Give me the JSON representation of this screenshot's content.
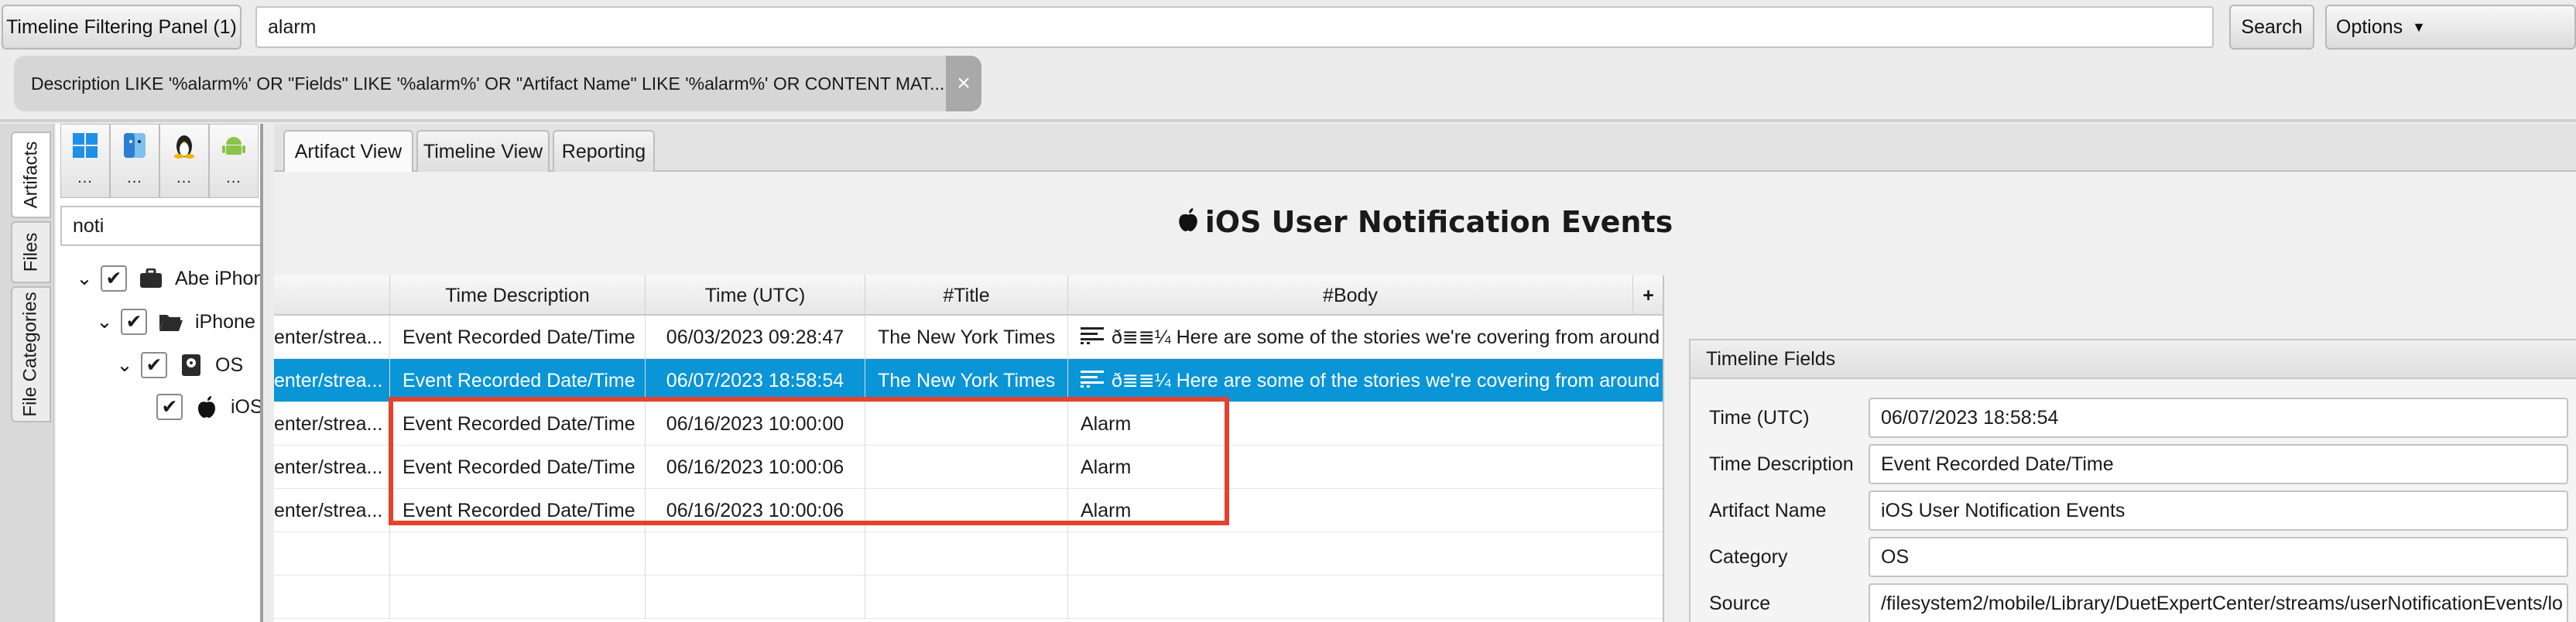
{
  "toolbar": {
    "filter_panel_button": "Timeline Filtering Panel (1)",
    "search_value": "alarm",
    "search_button": "Search",
    "options_button": "Options"
  },
  "filter_chip": {
    "text": "Description LIKE '%alarm%' OR \"Fields\" LIKE '%alarm%' OR \"Artifact Name\" LIKE '%alarm%' OR CONTENT MAT...",
    "close": "×"
  },
  "side_tabs": [
    "Artifacts",
    "Files",
    "File Categories"
  ],
  "os_buttons": [
    {
      "icon": "windows-icon",
      "label": "..."
    },
    {
      "icon": "mac-finder-icon",
      "label": "..."
    },
    {
      "icon": "linux-icon",
      "label": "..."
    },
    {
      "icon": "android-icon",
      "label": "..."
    }
  ],
  "tree_filter": "noti",
  "tree": [
    {
      "label": "Abe iPhon",
      "icon": "briefcase-icon"
    },
    {
      "label": "iPhone X",
      "icon": "folder-open-icon"
    },
    {
      "label": "OS",
      "icon": "drive-icon"
    },
    {
      "label": "iOS",
      "icon": "apple-icon"
    }
  ],
  "tabs": [
    "Artifact View",
    "Timeline View",
    "Reporting"
  ],
  "view_title": "iOS User Notification Events",
  "table": {
    "columns": [
      "",
      "Time Description",
      "Time (UTC)",
      "#Title",
      "#Body"
    ],
    "add_column": "+",
    "rows": [
      {
        "source": "enter/strea...",
        "desc": "Event Recorded Date/Time",
        "time": "06/03/2023 09:28:47",
        "title": "The New York Times",
        "body": "ð° Here are some of the stories we're covering from around th"
      },
      {
        "source": "enter/strea...",
        "desc": "Event Recorded Date/Time",
        "time": "06/07/2023 18:58:54",
        "title": "The New York Times",
        "body": "ð° Here are some of the stories we're covering from around th"
      },
      {
        "source": "enter/strea...",
        "desc": "Event Recorded Date/Time",
        "time": "06/16/2023 10:00:00",
        "title": "",
        "body": "Alarm"
      },
      {
        "source": "enter/strea...",
        "desc": "Event Recorded Date/Time",
        "time": "06/16/2023 10:00:06",
        "title": "",
        "body": "Alarm"
      },
      {
        "source": "enter/strea...",
        "desc": "Event Recorded Date/Time",
        "time": "06/16/2023 10:00:06",
        "title": "",
        "body": "Alarm"
      }
    ],
    "body_prefix": "ð≣≣¼"
  },
  "timeline_fields": {
    "header": "Timeline Fields",
    "fields": [
      {
        "label": "Time (UTC)",
        "value": "06/07/2023 18:58:54"
      },
      {
        "label": "Time Description",
        "value": "Event Recorded Date/Time"
      },
      {
        "label": "Artifact Name",
        "value": "iOS User Notification Events"
      },
      {
        "label": "Category",
        "value": "OS"
      },
      {
        "label": "Source",
        "value": "/filesystem2/mobile/Library/DuetExpertCenter/streams/userNotificationEvents/lo"
      }
    ]
  },
  "colors": {
    "selection": "#0a95d6",
    "highlight_box": "#e5412d"
  }
}
